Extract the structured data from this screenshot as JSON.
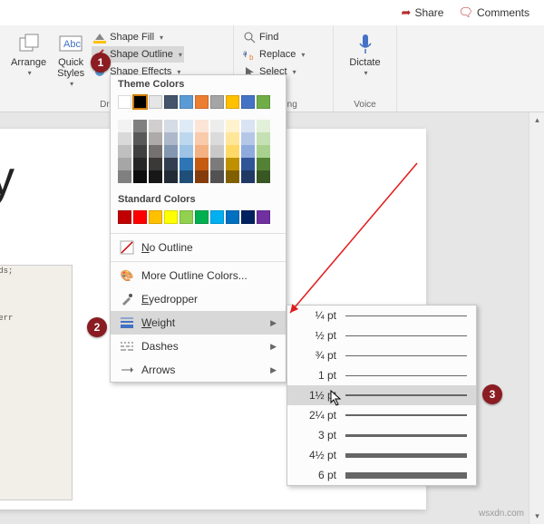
{
  "topbar": {
    "share": "Share",
    "comments": "Comments"
  },
  "ribbon": {
    "drawing": {
      "label": "Drawing",
      "arrange": "Arrange",
      "quick_styles": "Quick\nStyles",
      "shape_fill": "Shape Fill",
      "shape_outline": "Shape Outline",
      "shape_effects": "Shape Effects"
    },
    "editing": {
      "find": "Find",
      "replace": "Replace",
      "select": "Select"
    },
    "voice": {
      "label": "Voice",
      "dictate": "Dictate"
    }
  },
  "menu": {
    "theme_colors": "Theme Colors",
    "standard_colors": "Standard Colors",
    "no_outline": "No Outline",
    "more_colors": "More Outline Colors...",
    "eyedropper": "Eyedropper",
    "weight": "Weight",
    "dashes": "Dashes",
    "arrows": "Arrows",
    "colors": {
      "top_row": [
        "#ffffff",
        "#000000",
        "#e7e6e6",
        "#44546a",
        "#5b9bd5",
        "#ed7d31",
        "#a5a5a5",
        "#ffc000",
        "#4472c4",
        "#70ad47"
      ],
      "cols": [
        [
          "#f2f2f2",
          "#d9d9d9",
          "#bfbfbf",
          "#a6a6a6",
          "#808080"
        ],
        [
          "#808080",
          "#595959",
          "#404040",
          "#262626",
          "#0d0d0d"
        ],
        [
          "#d0cece",
          "#aeaaaa",
          "#767171",
          "#3b3838",
          "#181717"
        ],
        [
          "#d6dce5",
          "#adb9ca",
          "#8497b0",
          "#333f50",
          "#222a35"
        ],
        [
          "#deebf7",
          "#bdd7ee",
          "#9dc3e6",
          "#2e75b6",
          "#1f4e79"
        ],
        [
          "#fbe5d6",
          "#f8cbad",
          "#f4b183",
          "#c55a11",
          "#843c0c"
        ],
        [
          "#ededed",
          "#dbdbdb",
          "#c9c9c9",
          "#7b7b7b",
          "#525252"
        ],
        [
          "#fff2cc",
          "#ffe699",
          "#ffd966",
          "#bf9000",
          "#806000"
        ],
        [
          "#dae3f3",
          "#b4c7e7",
          "#8faadc",
          "#2f5597",
          "#203864"
        ],
        [
          "#e2f0d9",
          "#c5e0b4",
          "#a9d18e",
          "#548235",
          "#385723"
        ]
      ],
      "standard": [
        "#c00000",
        "#ff0000",
        "#ffc000",
        "#ffff00",
        "#92d050",
        "#00b050",
        "#00b0f0",
        "#0070c0",
        "#002060",
        "#7030a0"
      ]
    }
  },
  "weights": [
    {
      "label": "¼ pt",
      "w": 0.5
    },
    {
      "label": "½ pt",
      "w": 0.7
    },
    {
      "label": "¾ pt",
      "w": 1
    },
    {
      "label": "1 pt",
      "w": 1.3
    },
    {
      "label": "1½ pt",
      "w": 2
    },
    {
      "label": "2¼ pt",
      "w": 2.7
    },
    {
      "label": "3 pt",
      "w": 3.5
    },
    {
      "label": "4½ pt",
      "w": 5
    },
    {
      "label": "6 pt",
      "w": 7
    }
  ],
  "slide": {
    "title_fragment": "ly",
    "subtitle_fragment": "s"
  },
  "callouts": {
    "c1": "1",
    "c2": "2",
    "c3": "3"
  },
  "watermark": "wsxdn.com"
}
